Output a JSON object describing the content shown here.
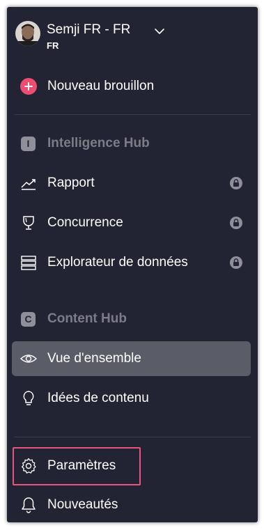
{
  "account": {
    "name": "Semji FR - FR",
    "workspace": "FR"
  },
  "new_draft": {
    "label": "Nouveau brouillon"
  },
  "intelligence_hub": {
    "badge": "I",
    "title": "Intelligence Hub",
    "items": [
      {
        "label": "Rapport",
        "icon": "chart-line-icon",
        "locked": true
      },
      {
        "label": "Concurrence",
        "icon": "trophy-icon",
        "locked": true
      },
      {
        "label": "Explorateur de données",
        "icon": "data-list-icon",
        "locked": true
      }
    ]
  },
  "content_hub": {
    "badge": "C",
    "title": "Content Hub",
    "items": [
      {
        "label": "Vue d'ensemble",
        "icon": "eye-icon",
        "active": true
      },
      {
        "label": "Idées de contenu",
        "icon": "lightbulb-icon",
        "active": false
      }
    ]
  },
  "footer": {
    "items": [
      {
        "label": "Paramètres",
        "icon": "gear-icon",
        "highlighted": true
      },
      {
        "label": "Nouveautés",
        "icon": "bell-icon"
      }
    ]
  },
  "colors": {
    "panel_bg": "#232433",
    "active_bg": "#5a5c67",
    "accent": "#ee4d72",
    "highlight_border": "#e9567d",
    "muted_text": "#7b7c86"
  }
}
